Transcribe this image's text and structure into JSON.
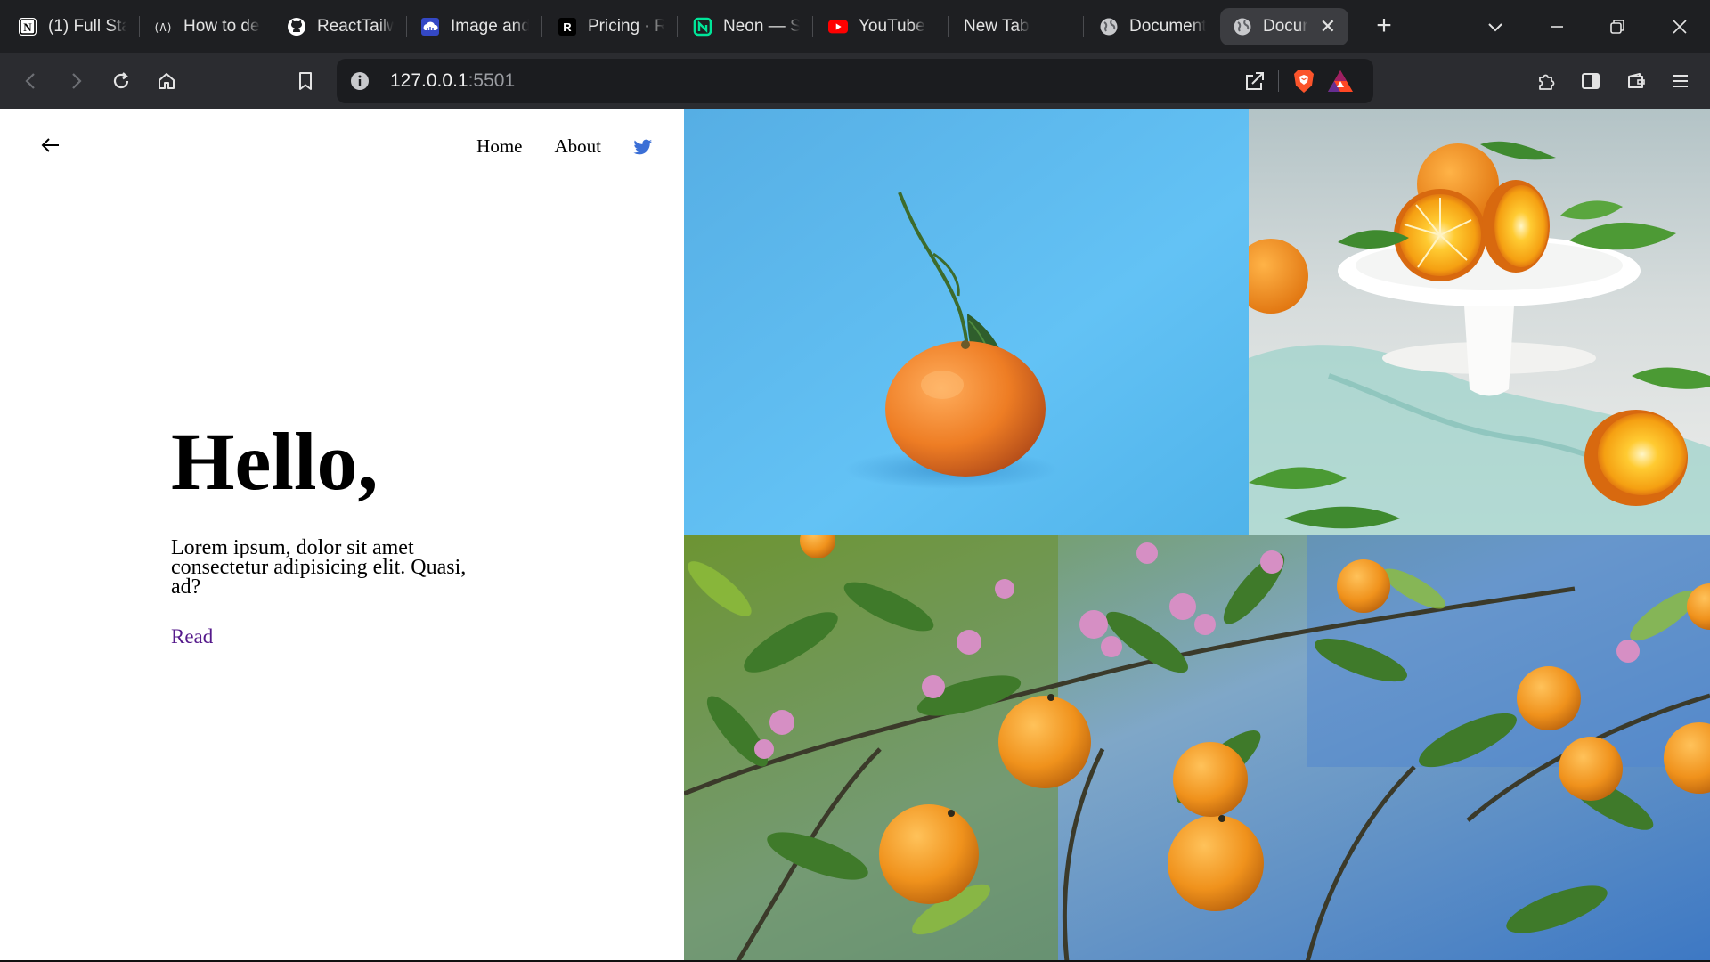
{
  "browser": {
    "tabs": [
      {
        "title": "(1) Full Sta",
        "icon": "notion-icon"
      },
      {
        "title": "How to de",
        "icon": "devto-icon"
      },
      {
        "title": "ReactTailw",
        "icon": "github-icon"
      },
      {
        "title": "Image and",
        "icon": "cloud-icon"
      },
      {
        "title": "Pricing · Re",
        "icon": "render-icon"
      },
      {
        "title": "Neon — S",
        "icon": "neon-icon"
      },
      {
        "title": "YouTube",
        "icon": "youtube-icon"
      },
      {
        "title": "New Tab",
        "icon": ""
      },
      {
        "title": "Document",
        "icon": "globe-icon"
      },
      {
        "title": "Docur",
        "icon": "globe-icon",
        "active": true
      }
    ],
    "url_host": "127.0.0.1",
    "url_port": ":5501",
    "colors": {
      "tabbar": "#1e1f22",
      "toolbar": "#2b2c30",
      "urlbar": "#1b1c1f",
      "active_tab": "#3c3d41"
    }
  },
  "page": {
    "nav": {
      "home": "Home",
      "about": "About",
      "twitter_icon": "twitter-icon"
    },
    "back_icon": "arrow-left-icon",
    "hero": {
      "title": "Hello,",
      "text": "Lorem ipsum, dolor sit amet consectetur adipisicing elit. Quasi, ad?",
      "link": "Read"
    },
    "photos": [
      {
        "subject": "tangerine-on-blue-background"
      },
      {
        "subject": "oranges-on-cake-stand"
      },
      {
        "subject": "orange-tree-with-blossoms"
      }
    ],
    "colors": {
      "link": "#551a8b",
      "twitter": "#3b6fd6"
    }
  }
}
